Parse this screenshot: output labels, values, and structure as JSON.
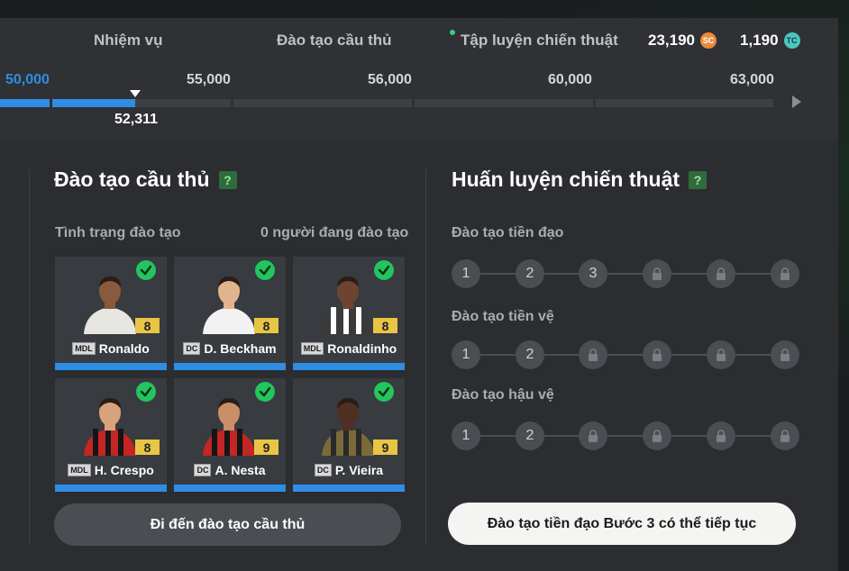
{
  "nav": {
    "tab_missions": "Nhiệm vụ",
    "tab_player_training": "Đào tạo cầu thủ",
    "tab_tactical_training": "Tập luyện chiến thuật"
  },
  "currency": {
    "sc_value": "23,190",
    "sc_icon": "SC",
    "tc_value": "1,190",
    "tc_icon": "TC"
  },
  "progress": {
    "milestones": [
      "50,000",
      "55,000",
      "56,000",
      "60,000",
      "63,000"
    ],
    "current": "52,311"
  },
  "player_training": {
    "title": "Đào tạo cầu thủ",
    "help": "?",
    "status_label": "Tình trạng đào tạo",
    "status_value": "0 người đang đào tạo",
    "players": [
      {
        "name": "Ronaldo",
        "position": "MDL",
        "ovr": "8"
      },
      {
        "name": "D. Beckham",
        "position": "DC",
        "ovr": "8"
      },
      {
        "name": "Ronaldinho",
        "position": "MDL",
        "ovr": "8"
      },
      {
        "name": "H. Crespo",
        "position": "MDL",
        "ovr": "8"
      },
      {
        "name": "A. Nesta",
        "position": "DC",
        "ovr": "9"
      },
      {
        "name": "P. Vieira",
        "position": "DC",
        "ovr": "9"
      }
    ],
    "button": "Đi đến đào tạo cầu thủ"
  },
  "tactical_training": {
    "title": "Huấn luyện chiến thuật",
    "help": "?",
    "tracks": [
      {
        "label": "Đào tạo tiền đạo",
        "steps": [
          "1",
          "2",
          "3"
        ]
      },
      {
        "label": "Đào tạo tiền vệ",
        "steps": [
          "1",
          "2"
        ]
      },
      {
        "label": "Đào tạo hậu vệ",
        "steps": [
          "1",
          "2"
        ]
      }
    ],
    "button": "Đào tạo tiền đạo Bước 3 có thể tiếp tục"
  },
  "colors": {
    "accent_blue": "#2f8de4",
    "check_green": "#22c55e",
    "ovr_gold": "#e9c546"
  }
}
